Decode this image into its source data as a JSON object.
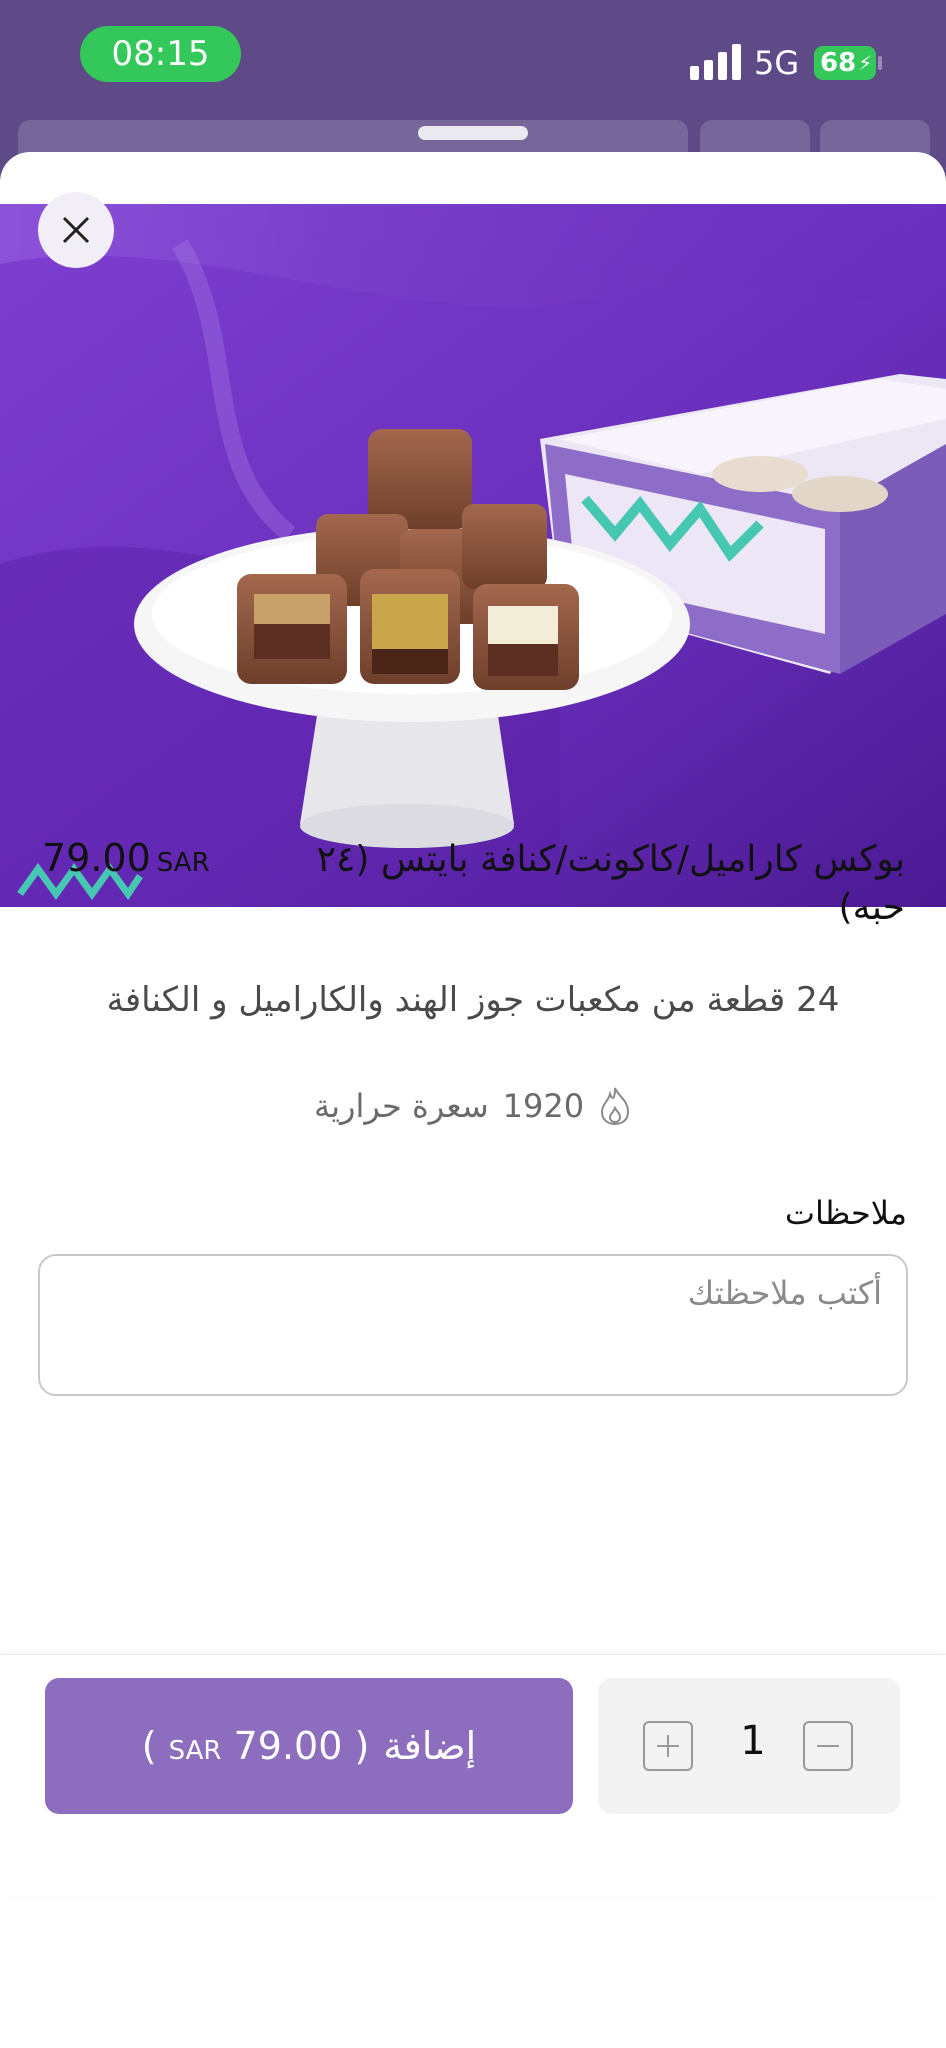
{
  "status": {
    "time": "08:15",
    "network": "5G",
    "battery": "68"
  },
  "product": {
    "title": "بوكس كاراميل/كاكونت/كنافة بايتس (٢٤ حبه)",
    "price": "79.00",
    "currency": "SAR",
    "description": "24 قطعة من مكعبات جوز الهند والكاراميل و الكنافة",
    "calories_value": "1920",
    "calories_unit": "سعرة حرارية",
    "image_alt": "chocolate caramel coconut kunafa bites on a white stand with box"
  },
  "notes": {
    "label": "ملاحظات",
    "placeholder": "أكتب ملاحظتك",
    "value": ""
  },
  "cart": {
    "add_label": "إضافة",
    "price": "79.00",
    "currency": "SAR",
    "quantity": "1"
  },
  "colors": {
    "accent": "#8d6dbd",
    "status_bg": "#5d4a86",
    "battery": "#34c759"
  },
  "icons": [
    "close-icon",
    "flame-icon",
    "plus-icon",
    "minus-icon",
    "signal-icon"
  ]
}
